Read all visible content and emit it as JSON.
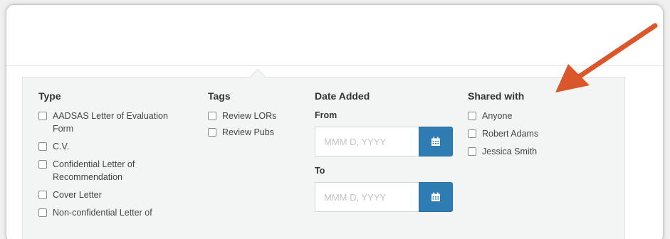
{
  "filters": {
    "type": {
      "title": "Type",
      "options": [
        "AADSAS Letter of Evaluation Form",
        "C.V.",
        "Confidential Letter of Recommendation",
        "Cover Letter",
        "Non-confidential Letter of"
      ]
    },
    "tags": {
      "title": "Tags",
      "options": [
        "Review LORs",
        "Review Pubs"
      ]
    },
    "date_added": {
      "title": "Date Added",
      "from_label": "From",
      "to_label": "To",
      "placeholder": "MMM D, YYYY"
    },
    "shared_with": {
      "title": "Shared with",
      "options": [
        "Anyone",
        "Robert Adams",
        "Jessica Smith"
      ]
    }
  },
  "colors": {
    "accent": "#2f7cb3",
    "annotation_arrow": "#d9572b",
    "panel_bg": "#f3f4f4"
  }
}
